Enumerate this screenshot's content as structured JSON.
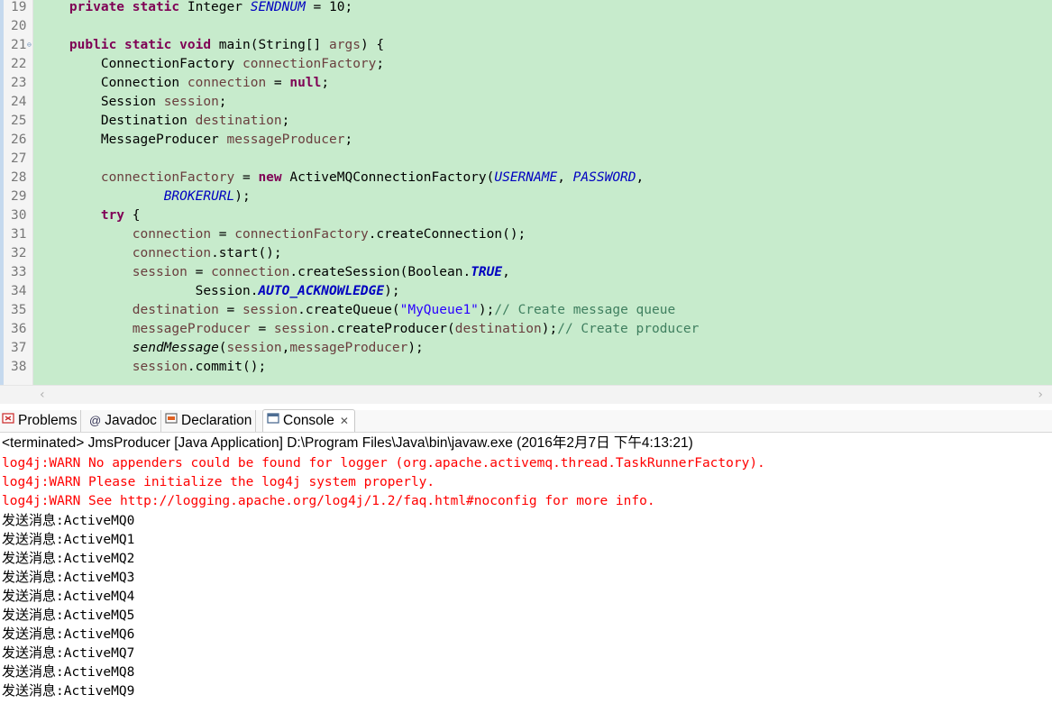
{
  "editor": {
    "lines": [
      {
        "num": "19",
        "parts": [
          {
            "t": "    "
          },
          {
            "t": "private static",
            "c": "kw"
          },
          {
            "t": " Integer "
          },
          {
            "t": "SENDNUM",
            "c": "cst"
          },
          {
            "t": " = 10;"
          }
        ]
      },
      {
        "num": "20",
        "parts": []
      },
      {
        "num": "21",
        "fold": true,
        "parts": [
          {
            "t": "    "
          },
          {
            "t": "public static void",
            "c": "kw"
          },
          {
            "t": " main(String[] "
          },
          {
            "t": "args",
            "c": "var"
          },
          {
            "t": ") {"
          }
        ]
      },
      {
        "num": "22",
        "parts": [
          {
            "t": "        ConnectionFactory "
          },
          {
            "t": "connectionFactory",
            "c": "var"
          },
          {
            "t": ";"
          }
        ]
      },
      {
        "num": "23",
        "parts": [
          {
            "t": "        Connection "
          },
          {
            "t": "connection",
            "c": "var"
          },
          {
            "t": " = "
          },
          {
            "t": "null",
            "c": "kw"
          },
          {
            "t": ";"
          }
        ]
      },
      {
        "num": "24",
        "parts": [
          {
            "t": "        Session "
          },
          {
            "t": "session",
            "c": "var"
          },
          {
            "t": ";"
          }
        ]
      },
      {
        "num": "25",
        "parts": [
          {
            "t": "        Destination "
          },
          {
            "t": "destination",
            "c": "var"
          },
          {
            "t": ";"
          }
        ]
      },
      {
        "num": "26",
        "parts": [
          {
            "t": "        MessageProducer "
          },
          {
            "t": "messageProducer",
            "c": "var"
          },
          {
            "t": ";"
          }
        ]
      },
      {
        "num": "27",
        "parts": []
      },
      {
        "num": "28",
        "parts": [
          {
            "t": "        "
          },
          {
            "t": "connectionFactory",
            "c": "var"
          },
          {
            "t": " = "
          },
          {
            "t": "new",
            "c": "kw"
          },
          {
            "t": " ActiveMQConnectionFactory("
          },
          {
            "t": "USERNAME",
            "c": "cst"
          },
          {
            "t": ", "
          },
          {
            "t": "PASSWORD",
            "c": "cst"
          },
          {
            "t": ","
          }
        ]
      },
      {
        "num": "29",
        "parts": [
          {
            "t": "                "
          },
          {
            "t": "BROKERURL",
            "c": "cst"
          },
          {
            "t": ");"
          }
        ]
      },
      {
        "num": "30",
        "parts": [
          {
            "t": "        "
          },
          {
            "t": "try",
            "c": "kw"
          },
          {
            "t": " {"
          }
        ]
      },
      {
        "num": "31",
        "parts": [
          {
            "t": "            "
          },
          {
            "t": "connection",
            "c": "var"
          },
          {
            "t": " = "
          },
          {
            "t": "connectionFactory",
            "c": "var"
          },
          {
            "t": ".createConnection();"
          }
        ]
      },
      {
        "num": "32",
        "parts": [
          {
            "t": "            "
          },
          {
            "t": "connection",
            "c": "var"
          },
          {
            "t": ".start();"
          }
        ]
      },
      {
        "num": "33",
        "parts": [
          {
            "t": "            "
          },
          {
            "t": "session",
            "c": "var"
          },
          {
            "t": " = "
          },
          {
            "t": "connection",
            "c": "var"
          },
          {
            "t": ".createSession(Boolean."
          },
          {
            "t": "TRUE",
            "c": "cstb"
          },
          {
            "t": ","
          }
        ]
      },
      {
        "num": "34",
        "parts": [
          {
            "t": "                    Session."
          },
          {
            "t": "AUTO_ACKNOWLEDGE",
            "c": "cstb"
          },
          {
            "t": ");"
          }
        ]
      },
      {
        "num": "35",
        "parts": [
          {
            "t": "            "
          },
          {
            "t": "destination",
            "c": "var"
          },
          {
            "t": " = "
          },
          {
            "t": "session",
            "c": "var"
          },
          {
            "t": ".createQueue("
          },
          {
            "t": "\"MyQueue1\"",
            "c": "str"
          },
          {
            "t": ");"
          },
          {
            "t": "// Create message queue",
            "c": "cmt"
          }
        ]
      },
      {
        "num": "36",
        "parts": [
          {
            "t": "            "
          },
          {
            "t": "messageProducer",
            "c": "var"
          },
          {
            "t": " = "
          },
          {
            "t": "session",
            "c": "var"
          },
          {
            "t": ".createProducer("
          },
          {
            "t": "destination",
            "c": "var"
          },
          {
            "t": ");"
          },
          {
            "t": "// Create producer",
            "c": "cmt"
          }
        ]
      },
      {
        "num": "37",
        "parts": [
          {
            "t": "            "
          },
          {
            "t": "sendMessage",
            "c": "mth"
          },
          {
            "t": "("
          },
          {
            "t": "session",
            "c": "var"
          },
          {
            "t": ","
          },
          {
            "t": "messageProducer",
            "c": "var"
          },
          {
            "t": ");"
          }
        ]
      },
      {
        "num": "38",
        "parts": [
          {
            "t": "            "
          },
          {
            "t": "session",
            "c": "var"
          },
          {
            "t": ".commit();"
          }
        ]
      }
    ]
  },
  "tabs": [
    {
      "label": "Problems",
      "icon": "problems-icon"
    },
    {
      "label": "Javadoc",
      "icon": "javadoc-icon"
    },
    {
      "label": "Declaration",
      "icon": "declaration-icon"
    },
    {
      "label": "Console",
      "icon": "console-icon",
      "active": true,
      "close": "✕"
    }
  ],
  "console": {
    "header": "<terminated> JmsProducer [Java Application] D:\\Program Files\\Java\\bin\\javaw.exe (2016年2月7日 下午4:13:21)",
    "lines": [
      {
        "text": "log4j:WARN No appenders could be found for logger (org.apache.activemq.thread.TaskRunnerFactory).",
        "type": "err"
      },
      {
        "text": "log4j:WARN Please initialize the log4j system properly.",
        "type": "err"
      },
      {
        "text": "log4j:WARN See http://logging.apache.org/log4j/1.2/faq.html#noconfig for more info.",
        "type": "err"
      },
      {
        "prefix": "发送消息",
        "text": ":ActiveMQ0",
        "type": "out"
      },
      {
        "prefix": "发送消息",
        "text": ":ActiveMQ1",
        "type": "out"
      },
      {
        "prefix": "发送消息",
        "text": ":ActiveMQ2",
        "type": "out"
      },
      {
        "prefix": "发送消息",
        "text": ":ActiveMQ3",
        "type": "out"
      },
      {
        "prefix": "发送消息",
        "text": ":ActiveMQ4",
        "type": "out"
      },
      {
        "prefix": "发送消息",
        "text": ":ActiveMQ5",
        "type": "out"
      },
      {
        "prefix": "发送消息",
        "text": ":ActiveMQ6",
        "type": "out"
      },
      {
        "prefix": "发送消息",
        "text": ":ActiveMQ7",
        "type": "out"
      },
      {
        "prefix": "发送消息",
        "text": ":ActiveMQ8",
        "type": "out"
      },
      {
        "prefix": "发送消息",
        "text": ":ActiveMQ9",
        "type": "out"
      }
    ]
  }
}
